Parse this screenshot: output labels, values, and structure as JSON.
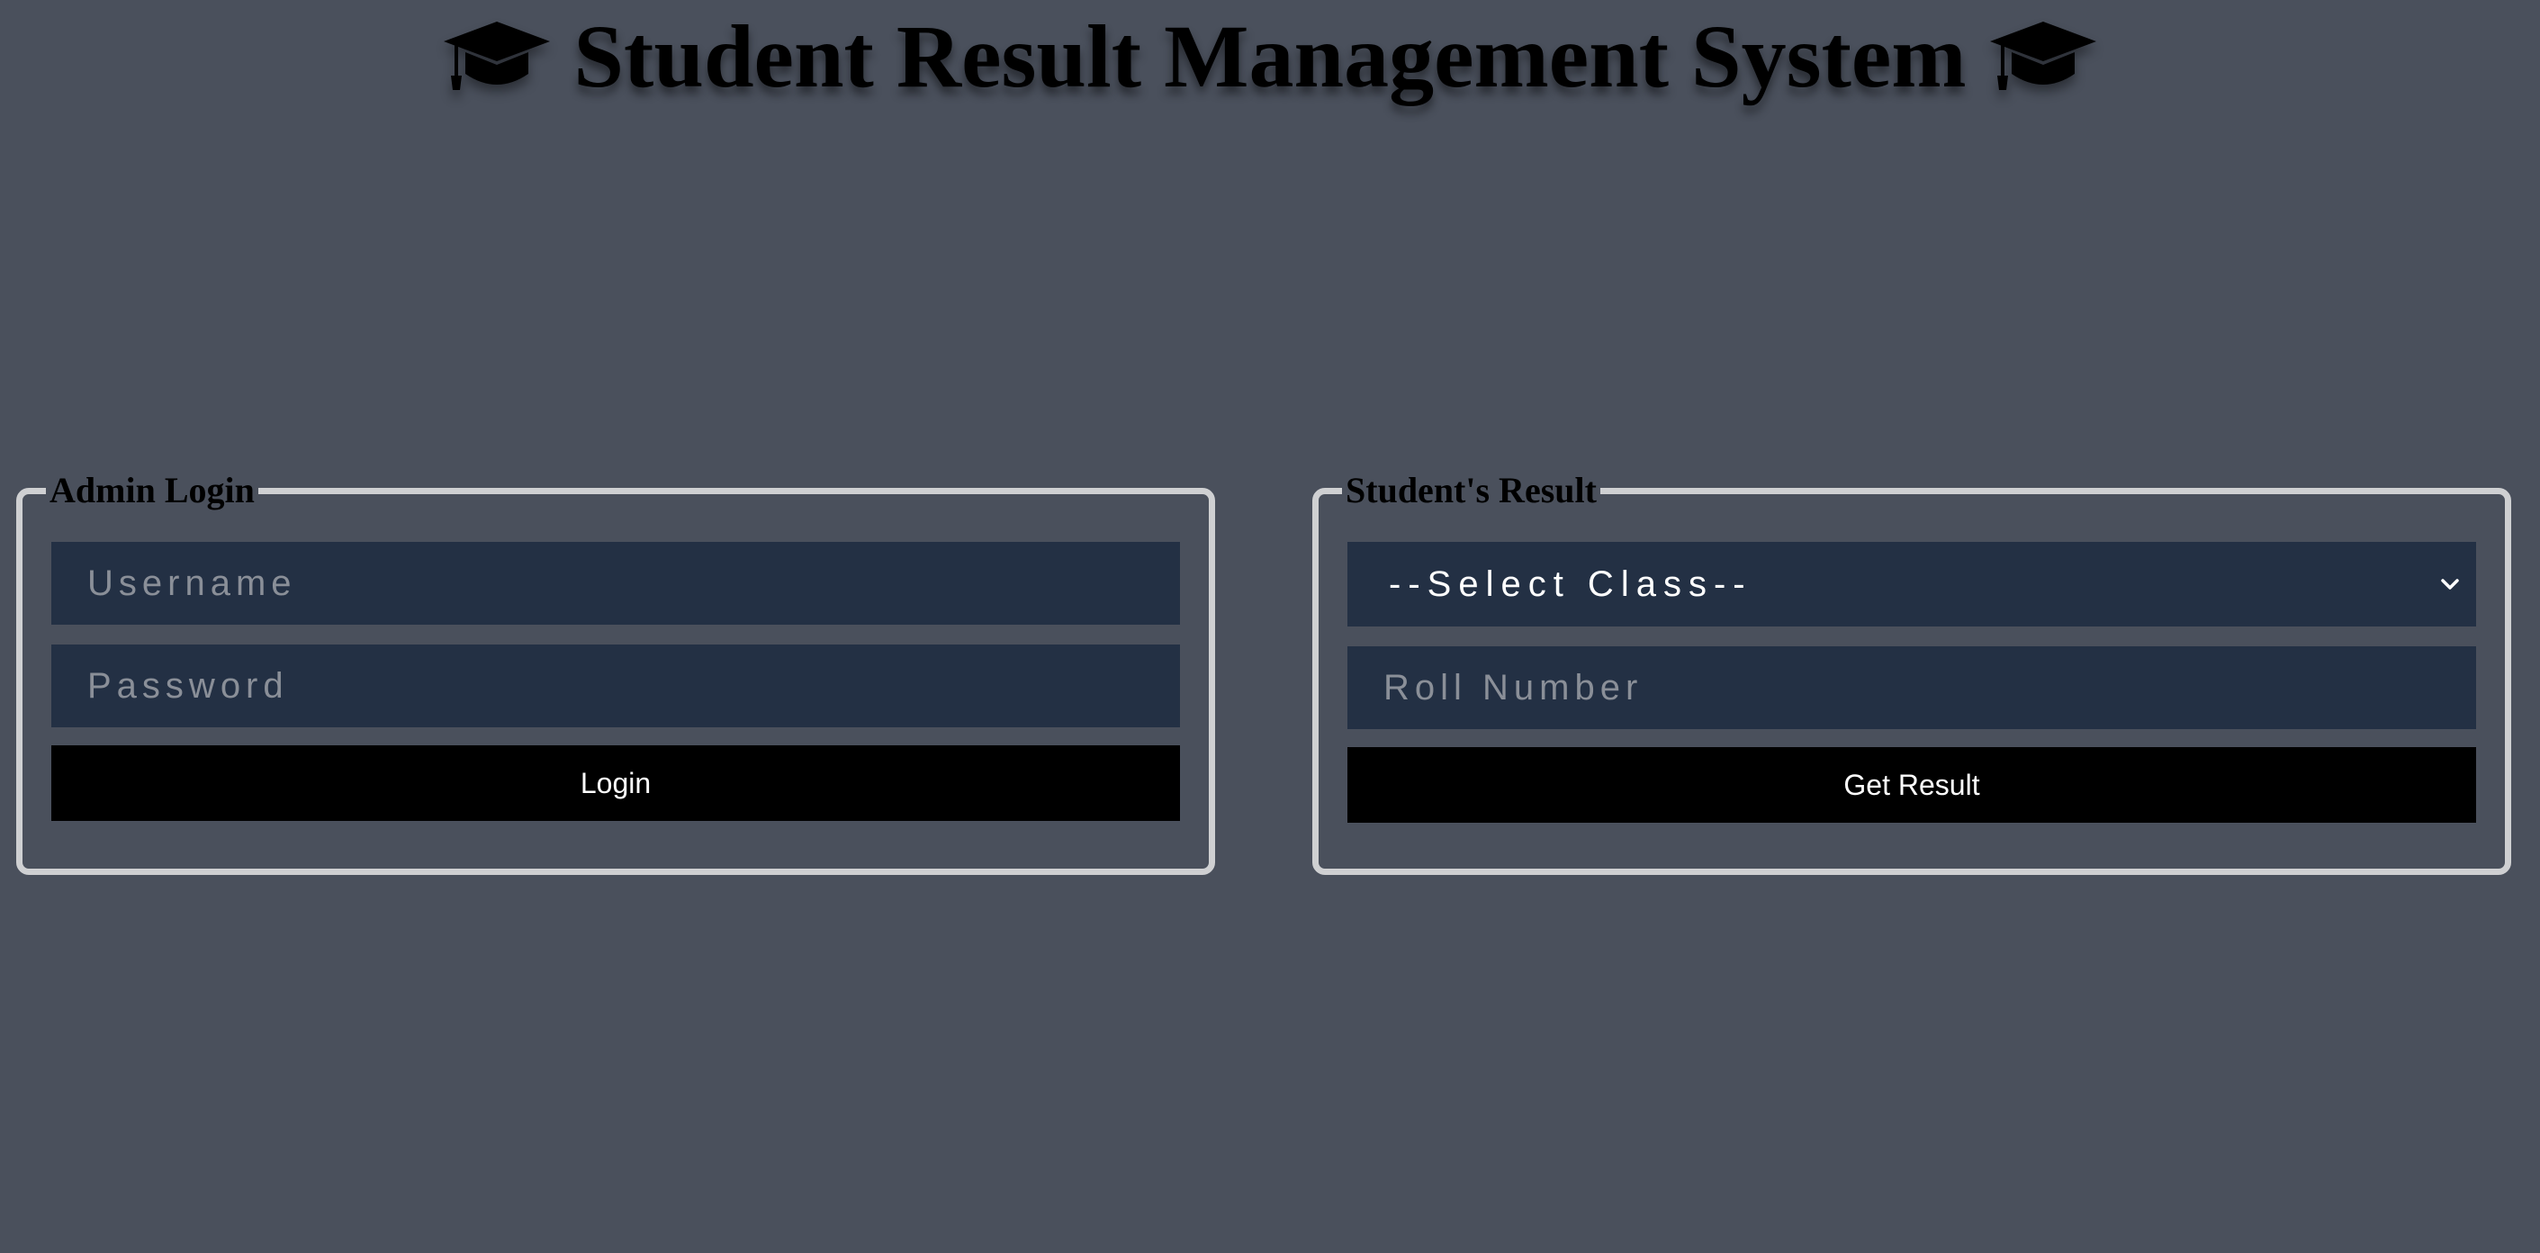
{
  "header": {
    "title": "Student Result Management System",
    "icon_left": "graduation-cap-icon",
    "icon_right": "graduation-cap-icon"
  },
  "admin_login": {
    "legend": "Admin Login",
    "username_placeholder": "Username",
    "password_placeholder": "Password",
    "login_label": "Login"
  },
  "student_result": {
    "legend": "Student's Result",
    "class_select_value": "--Select Class--",
    "roll_placeholder": "Roll Number",
    "get_result_label": "Get Result"
  },
  "colors": {
    "background": "#4a505c",
    "input_background": "#233044",
    "button_background": "#000000",
    "panel_border": "#cfd0d2"
  }
}
